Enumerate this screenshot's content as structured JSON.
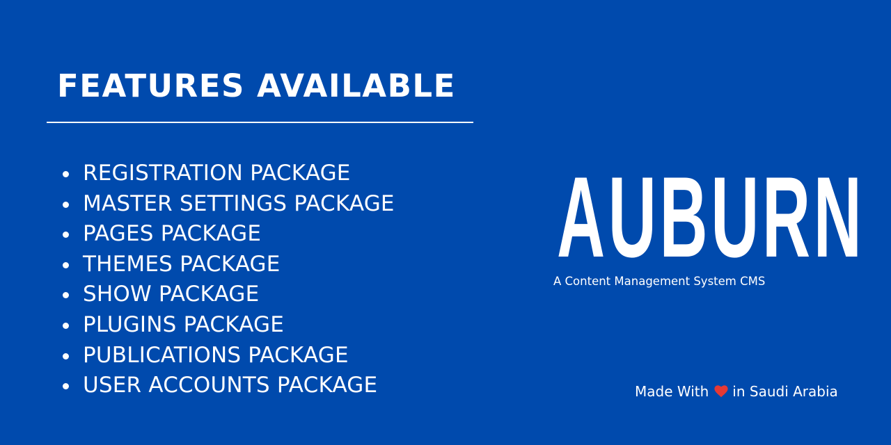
{
  "heading": "FEATURES AVAILABLE",
  "features": [
    "REGISTRATION PACKAGE",
    "MASTER SETTINGS PACKAGE",
    "PAGES PACKAGE",
    "THEMES PACKAGE",
    "SHOW PACKAGE",
    "PLUGINS PACKAGE",
    "PUBLICATIONS PACKAGE",
    "USER ACCOUNTS PACKAGE"
  ],
  "brand": {
    "name": "AUBURN",
    "tagline": "A Content Management System CMS"
  },
  "credit": {
    "prefix": "Made With",
    "icon": "heart-icon",
    "suffix": "in Saudi Arabia"
  },
  "colors": {
    "background": "#004aad",
    "text": "#ffffff",
    "heart": "#e53935"
  }
}
